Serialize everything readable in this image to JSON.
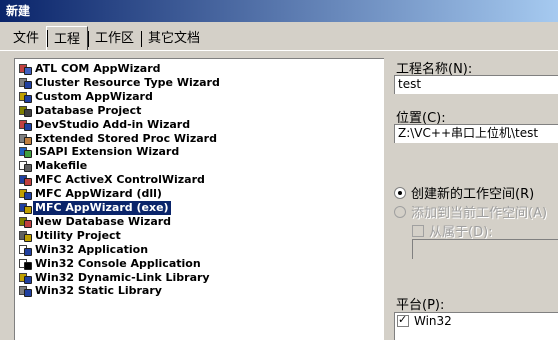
{
  "window": {
    "title": "新建"
  },
  "tabs": [
    {
      "label": "文件"
    },
    {
      "label": "工程"
    },
    {
      "label": "工作区"
    },
    {
      "label": "其它文档"
    }
  ],
  "projects": [
    {
      "label": "ATL COM AppWizard",
      "icon": "atl-com-icon",
      "colors": [
        "#c04040",
        "#4060c0"
      ]
    },
    {
      "label": "Cluster Resource Type Wizard",
      "icon": "cluster-icon",
      "colors": [
        "#808080",
        "#2040a0"
      ]
    },
    {
      "label": "Custom AppWizard",
      "icon": "custom-appwizard-icon",
      "colors": [
        "#c0a000",
        "#2040a0"
      ]
    },
    {
      "label": "Database Project",
      "icon": "database-icon",
      "colors": [
        "#808000",
        "#404040"
      ]
    },
    {
      "label": "DevStudio Add-in Wizard",
      "icon": "addin-icon",
      "colors": [
        "#c04040",
        "#2040a0"
      ]
    },
    {
      "label": "Extended Stored Proc Wizard",
      "icon": "stored-proc-icon",
      "colors": [
        "#808080",
        "#c08040"
      ]
    },
    {
      "label": "ISAPI Extension Wizard",
      "icon": "isapi-icon",
      "colors": [
        "#2060c0",
        "#40a040"
      ]
    },
    {
      "label": "Makefile",
      "icon": "makefile-icon",
      "colors": [
        "#ffffff",
        "#606060"
      ]
    },
    {
      "label": "MFC ActiveX ControlWizard",
      "icon": "activex-icon",
      "colors": [
        "#2040a0",
        "#c04040"
      ]
    },
    {
      "label": "MFC AppWizard (dll)",
      "icon": "mfc-dll-icon",
      "colors": [
        "#c0a000",
        "#2040a0"
      ]
    },
    {
      "label": "MFC AppWizard (exe)",
      "icon": "mfc-exe-icon",
      "colors": [
        "#2040a0",
        "#c0a000"
      ],
      "selected": true
    },
    {
      "label": "New Database Wizard",
      "icon": "new-db-icon",
      "colors": [
        "#808000",
        "#c04040"
      ]
    },
    {
      "label": "Utility Project",
      "icon": "utility-icon",
      "colors": [
        "#606060",
        "#c0a000"
      ]
    },
    {
      "label": "Win32 Application",
      "icon": "win32-app-icon",
      "colors": [
        "#ffffff",
        "#2040a0"
      ]
    },
    {
      "label": "Win32 Console Application",
      "icon": "console-icon",
      "colors": [
        "#ffffff",
        "#000000"
      ]
    },
    {
      "label": "Win32 Dynamic-Link Library",
      "icon": "dll-icon",
      "colors": [
        "#c0a000",
        "#2040a0"
      ]
    },
    {
      "label": "Win32 Static Library",
      "icon": "static-lib-icon",
      "colors": [
        "#808080",
        "#2040a0"
      ]
    }
  ],
  "project_name": {
    "label": "工程名称(N):",
    "value": "test"
  },
  "location": {
    "label": "位置(C):",
    "value": "Z:\\VC++串口上位机\\test"
  },
  "workspace_options": {
    "create_new": "创建新的工作空间(R)",
    "add_to_current": "添加到当前工作空间(A)",
    "depends_on": "从属于(D):"
  },
  "platforms": {
    "label": "平台(P):",
    "items": [
      {
        "label": "Win32",
        "checked": true
      }
    ]
  }
}
